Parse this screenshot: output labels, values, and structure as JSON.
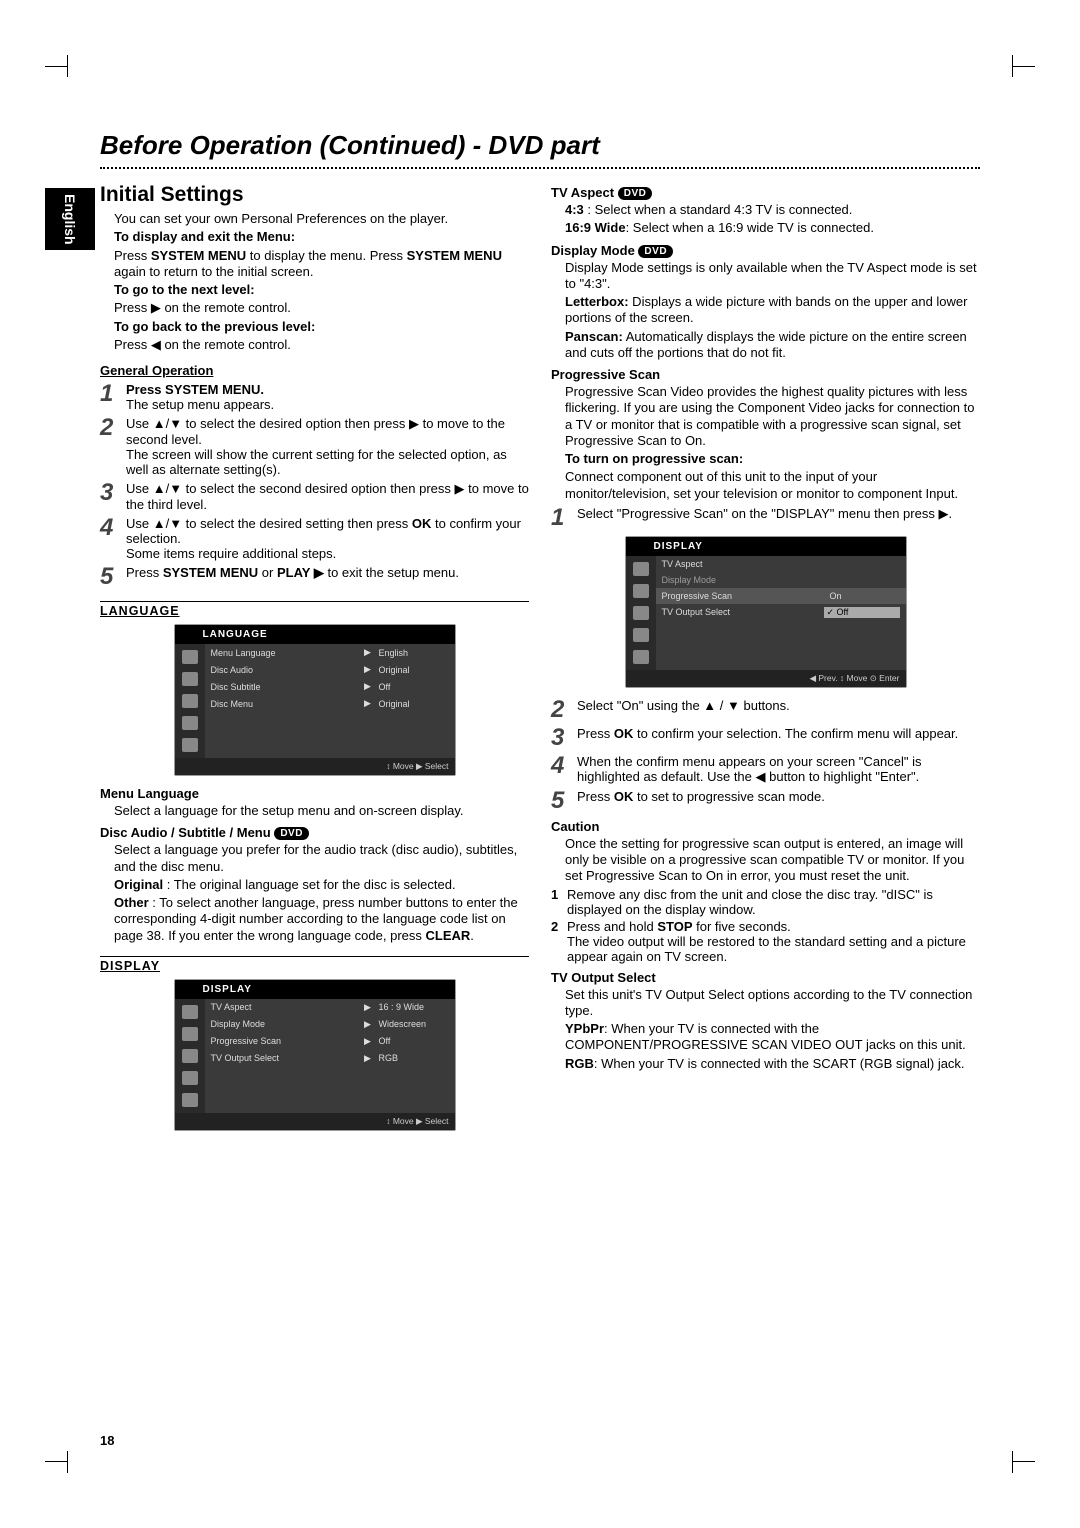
{
  "page_number": "18",
  "side_tab": "English",
  "title": "Before Operation (Continued) - DVD part",
  "left": {
    "h2": "Initial Settings",
    "intro": "You can set your own Personal Preferences on the player.",
    "to_display_label": "To display and exit the Menu:",
    "to_display_body1": "Press SYSTEM MENU to display the menu. Press SYSTEM MENU again to return to the initial screen.",
    "to_next_label": "To go to the next level:",
    "to_next_body": "Press ▶ on the remote control.",
    "to_prev_label": "To go back to the previous level:",
    "to_prev_body": "Press ◀ on the remote control.",
    "gen_op_header": "General Operation",
    "steps": [
      {
        "num": "1",
        "bold": "Press SYSTEM MENU.",
        "rest": "The setup menu appears."
      },
      {
        "num": "2",
        "body": "Use ▲/▼ to select the desired option then press ▶ to move to the second level.\nThe screen will show the current setting for the selected option, as well as alternate setting(s)."
      },
      {
        "num": "3",
        "body": "Use ▲/▼ to select the second desired option then press ▶ to move to the third level."
      },
      {
        "num": "4",
        "body": "Use ▲/▼ to select the desired setting then press OK to confirm your selection.\nSome items require additional steps."
      },
      {
        "num": "5",
        "body": "Press SYSTEM MENU or PLAY ▶ to exit the setup menu."
      }
    ],
    "lang_header": "LANGUAGE",
    "osd1": {
      "title": "LANGUAGE",
      "rows": [
        {
          "label": "Menu Language",
          "val": "English"
        },
        {
          "label": "Disc Audio",
          "val": "Original"
        },
        {
          "label": "Disc Subtitle",
          "val": "Off"
        },
        {
          "label": "Disc Menu",
          "val": "Original"
        }
      ],
      "foot": "↕ Move   ▶ Select"
    },
    "menu_lang_h": "Menu Language",
    "menu_lang_p": "Select a language for the setup menu and on-screen display.",
    "disc_aud_h": "Disc Audio / Subtitle / Menu",
    "disc_aud_p1": "Select a language you prefer for the audio track (disc audio), subtitles, and the disc menu.",
    "disc_aud_original": "Original : The original language set for the disc is selected.",
    "disc_aud_other": "Other : To select another language, press number buttons to enter the corresponding 4-digit number according to the language code list on page 38. If you enter the wrong language code, press CLEAR.",
    "display_header": "DISPLAY",
    "osd2": {
      "title": "DISPLAY",
      "rows": [
        {
          "label": "TV Aspect",
          "val": "16 : 9 Wide"
        },
        {
          "label": "Display Mode",
          "val": "Widescreen"
        },
        {
          "label": "Progressive Scan",
          "val": "Off"
        },
        {
          "label": "TV Output Select",
          "val": "RGB"
        }
      ],
      "foot": "↕ Move   ▶ Select"
    }
  },
  "right": {
    "tv_aspect_h": "TV Aspect",
    "tv_aspect_43": "4:3 : Select when a standard 4:3 TV is connected.",
    "tv_aspect_169": "16:9 Wide: Select when a 16:9 wide TV is connected.",
    "disp_mode_h": "Display Mode",
    "disp_mode_p": "Display Mode settings is only available when the TV Aspect mode is set to \"4:3\".",
    "disp_mode_letter": "Letterbox: Displays a wide picture with bands on the upper and lower portions of the screen.",
    "disp_mode_pan": "Panscan: Automatically displays the wide picture on the entire screen and cuts off the portions that do not fit.",
    "prog_h": "Progressive Scan",
    "prog_p": "Progressive Scan Video provides the highest quality pictures with less flickering. If you are using the Component Video jacks for connection to a TV or monitor that is compatible with a progressive scan signal, set Progressive Scan to On.",
    "prog_turn_on": "To turn on progressive scan:",
    "prog_turn_on_p": "Connect component out of this unit to the input of your monitor/television, set your television or monitor to component Input.",
    "prog_steps": [
      {
        "num": "1",
        "body": "Select \"Progressive Scan\" on the \"DISPLAY\" menu then press ▶."
      },
      {
        "num": "2",
        "body": "Select \"On\" using the ▲ / ▼ buttons."
      },
      {
        "num": "3",
        "body": "Press OK to confirm your selection. The confirm menu will appear."
      },
      {
        "num": "4",
        "body": "When the confirm menu appears on your screen \"Cancel\" is highlighted as default. Use the ◀ button to highlight \"Enter\"."
      },
      {
        "num": "5",
        "body": "Press OK to set to progressive scan mode."
      }
    ],
    "osd3": {
      "title": "DISPLAY",
      "rows": [
        {
          "label": "TV Aspect",
          "val": ""
        },
        {
          "label": "Display Mode",
          "val": "",
          "dim": true
        },
        {
          "label": "Progressive Scan",
          "val": "On",
          "sel": true
        },
        {
          "label": "TV Output Select",
          "val": "✓ Off",
          "box": true
        }
      ],
      "foot": "◀ Prev.   ↕ Move   ⊙ Enter"
    },
    "caution_h": "Caution",
    "caution_p": "Once the setting for progressive scan output is entered, an image will only be visible on a progressive scan compatible TV or monitor. If you set Progressive Scan to On in error, you must reset the unit.",
    "caution_steps": [
      {
        "num": "1",
        "body": "Remove any disc from the unit and close the disc tray. \"dISC\" is displayed on the display window."
      },
      {
        "num": "2",
        "body": "Press and hold STOP for five seconds.\nThe video output will be restored to the standard setting and a picture appear again on TV screen."
      }
    ],
    "tvout_h": "TV Output Select",
    "tvout_p": "Set this unit's TV Output Select options according to the TV connection type.",
    "tvout_ypbpr": "YPbPr: When your TV is connected with the COMPONENT/PROGRESSIVE SCAN VIDEO OUT jacks on this unit.",
    "tvout_rgb": "RGB: When your TV is connected with the SCART (RGB signal) jack."
  },
  "dvd_pill": "DVD"
}
